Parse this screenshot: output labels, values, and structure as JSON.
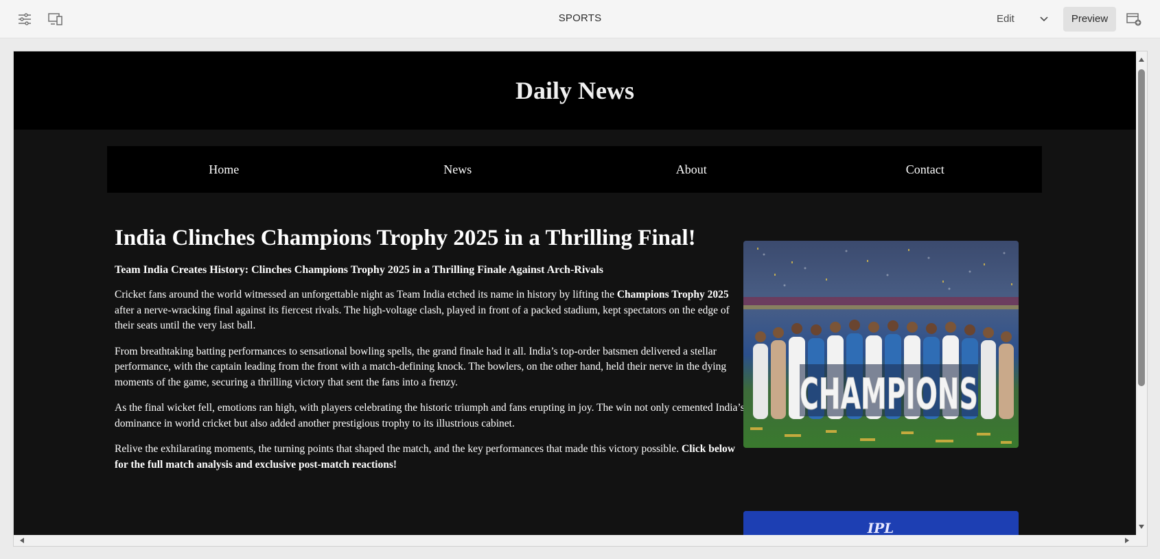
{
  "toolbar": {
    "left_icons": [
      "sliders-icon",
      "device-emulator-icon"
    ],
    "page_name": "SPORTS",
    "edit_label": "Edit",
    "preview_label": "Preview",
    "right_icon": "add-panel-icon"
  },
  "site": {
    "title": "Daily News",
    "nav": [
      "Home",
      "News",
      "About",
      "Contact"
    ]
  },
  "article": {
    "headline": "India Clinches Champions Trophy 2025 in a Thrilling Final!",
    "subheading": "Team India Creates History: Clinches Champions Trophy 2025 in a Thrilling Finale Against Arch-Rivals",
    "p1_a": "Cricket fans around the world witnessed an unforgettable night as Team India etched its name in history by lifting the ",
    "p1_bold": "Champions Trophy 2025",
    "p1_b": " after a nerve-wracking final against its fiercest rivals. The high-voltage clash, played in front of a packed stadium, kept spectators on the edge of their seats until the very last ball.",
    "p2": "From breathtaking batting performances to sensational bowling spells, the grand finale had it all. India’s top-order batsmen delivered a stellar performance, with the captain leading from the front with a match-defining knock. The bowlers, on the other hand, held their nerve in the dying moments of the game, securing a thrilling victory that sent the fans into a frenzy.",
    "p3": "As the final wicket fell, emotions ran high, with players celebrating the historic triumph and fans erupting in joy. The win not only cemented India’s dominance in world cricket but also added another prestigious trophy to its illustrious cabinet.",
    "p4_a": "Relive the exhilarating moments, the turning points that shaped the match, and the key performances that made this victory possible. ",
    "p4_bold": "Click below for the full match analysis and exclusive post-match reactions!",
    "image_text": "CHAMPIONS",
    "second_image_text": "IPL"
  },
  "colors": {
    "header_bg": "#000000",
    "page_bg": "#121212",
    "text": "#ffffff",
    "toolbar_bg": "#f5f5f5"
  }
}
